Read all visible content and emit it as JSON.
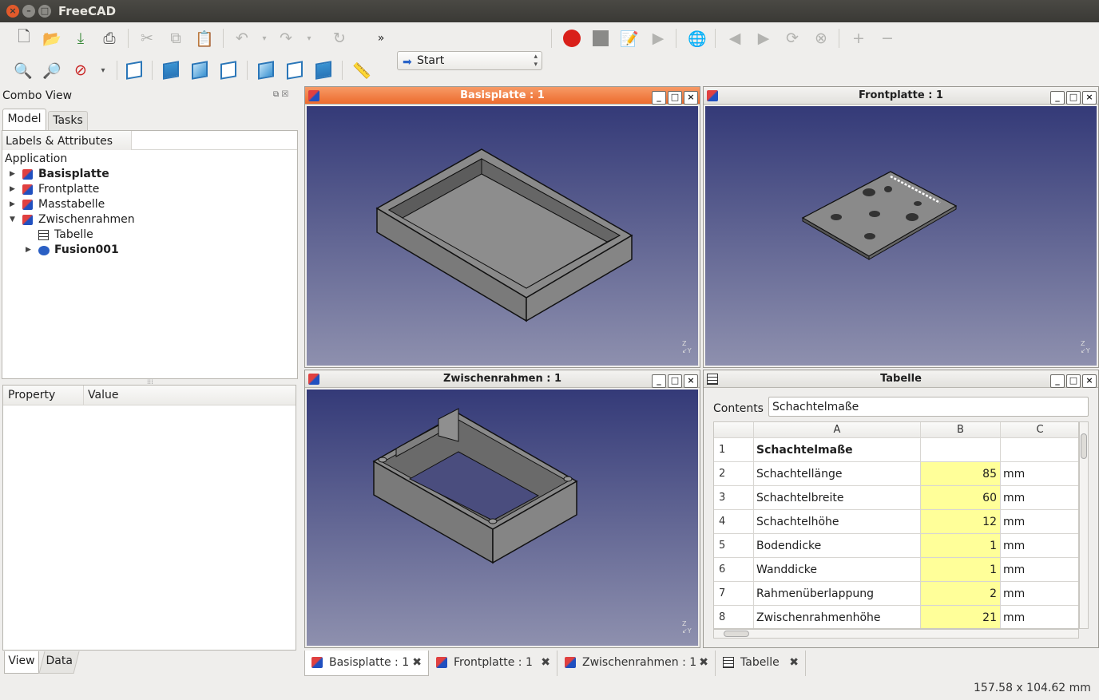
{
  "window": {
    "title": "FreeCAD"
  },
  "toolbar": {
    "workbench": "Start",
    "more": "»"
  },
  "combo_view": {
    "title": "Combo View",
    "tabs": [
      "Model",
      "Tasks"
    ],
    "tree_header": "Labels & Attributes",
    "tree_root": "Application",
    "items": [
      {
        "label": "Basisplatte",
        "bold": true
      },
      {
        "label": "Frontplatte",
        "bold": false
      },
      {
        "label": "Masstabelle",
        "bold": false
      },
      {
        "label": "Zwischenrahmen",
        "bold": false
      },
      {
        "label": "Tabelle",
        "bold": false
      },
      {
        "label": "Fusion001",
        "bold": true
      }
    ],
    "property_headers": [
      "Property",
      "Value"
    ],
    "bottom_tabs": [
      "View",
      "Data"
    ]
  },
  "views": {
    "basisplatte": "Basisplatte : 1",
    "frontplatte": "Frontplatte : 1",
    "zwischenrahmen": "Zwischenrahmen : 1",
    "tabelle": "Tabelle"
  },
  "spreadsheet": {
    "contents_label": "Contents",
    "contents_value": "Schachtelmaße",
    "columns": [
      "A",
      "B",
      "C"
    ],
    "rows": [
      {
        "n": "1",
        "a": "Schachtelmaße",
        "b": "",
        "c": ""
      },
      {
        "n": "2",
        "a": "Schachtellänge",
        "b": "85",
        "c": "mm"
      },
      {
        "n": "3",
        "a": "Schachtelbreite",
        "b": "60",
        "c": "mm"
      },
      {
        "n": "4",
        "a": "Schachtelhöhe",
        "b": "12",
        "c": "mm"
      },
      {
        "n": "5",
        "a": "Bodendicke",
        "b": "1",
        "c": "mm"
      },
      {
        "n": "6",
        "a": "Wanddicke",
        "b": "1",
        "c": "mm"
      },
      {
        "n": "7",
        "a": "Rahmenüberlappung",
        "b": "2",
        "c": "mm"
      },
      {
        "n": "8",
        "a": "Zwischenrahmenhöhe",
        "b": "21",
        "c": "mm"
      }
    ],
    "highlight_color": "#ffff99"
  },
  "doc_tabs": [
    "Basisplatte : 1",
    "Frontplatte : 1",
    "Zwischenrahmen : 1",
    "Tabelle"
  ],
  "status": {
    "dimensions": "157.58 x 104.62 mm"
  },
  "colors": {
    "active_title": "#ec6b2d",
    "viewport_top": "#343a78",
    "viewport_bottom": "#8e90ae"
  }
}
